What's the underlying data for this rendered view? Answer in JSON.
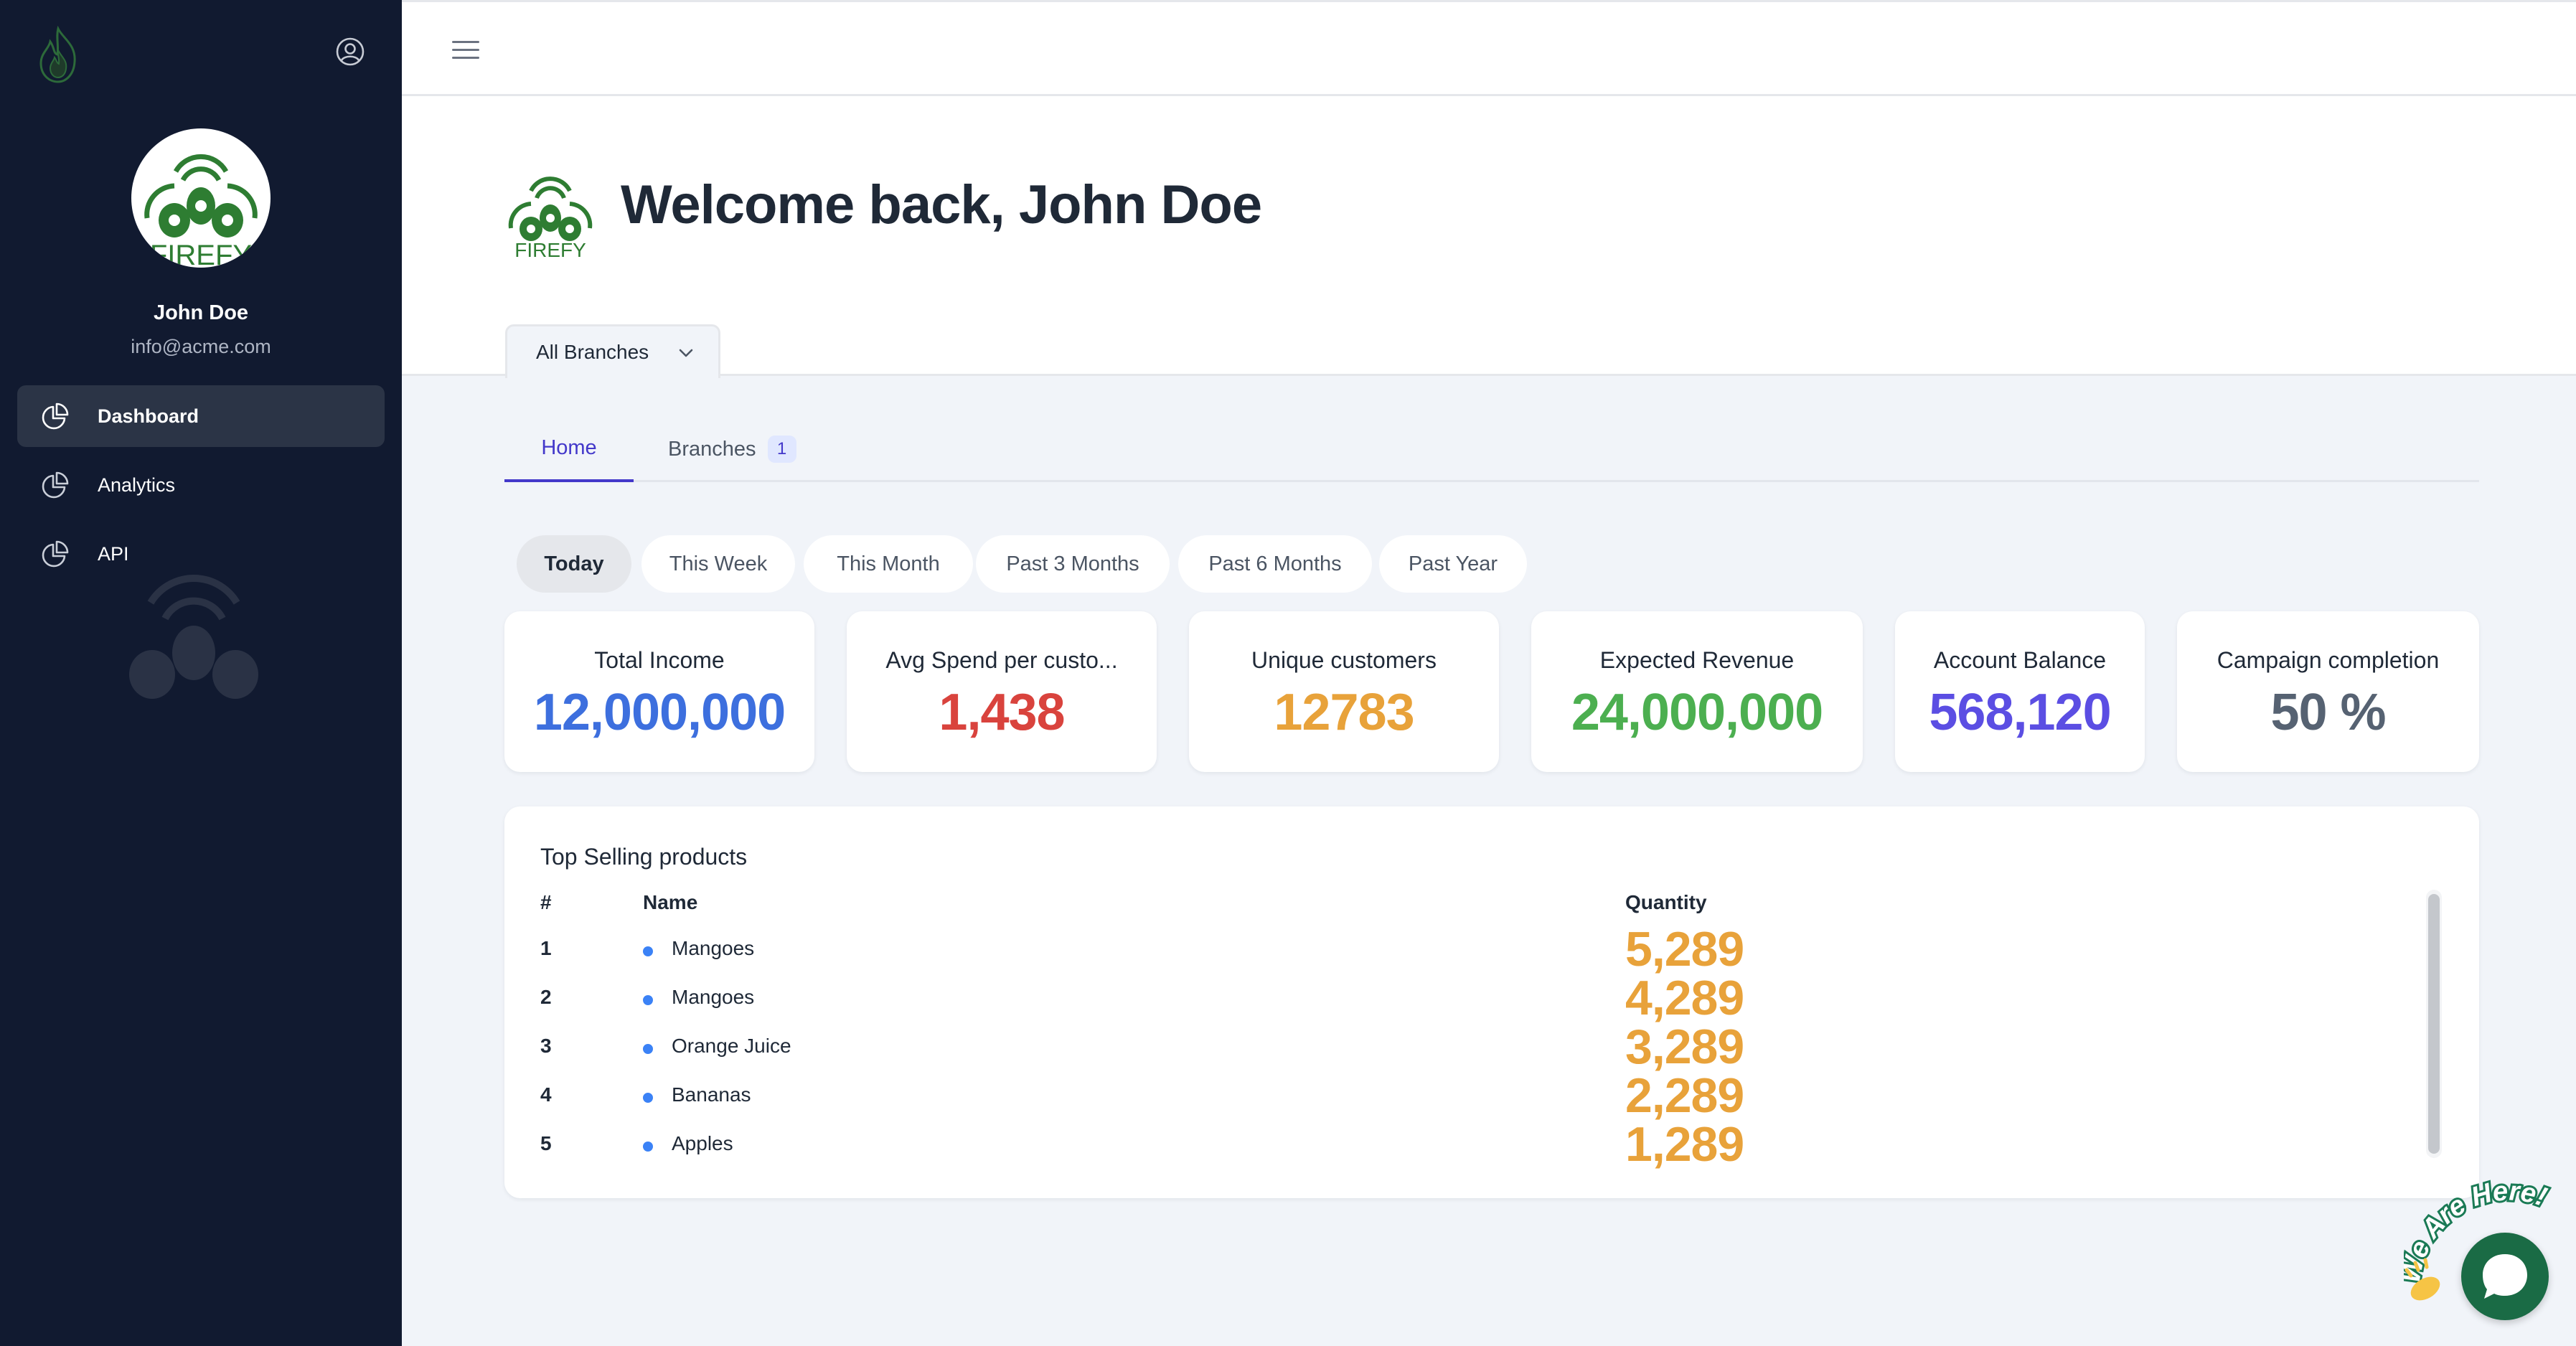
{
  "sidebar": {
    "user_name": "John Doe",
    "user_email": "info@acme.com",
    "avatar_text": "FIREFY",
    "nav": [
      {
        "label": "Dashboard",
        "active": true
      },
      {
        "label": "Analytics",
        "active": false
      },
      {
        "label": "API",
        "active": false
      }
    ]
  },
  "header": {
    "welcome": "Welcome back, John Doe",
    "logo_text": "FIREFY",
    "branch_select": "All Branches"
  },
  "tabs": [
    {
      "label": "Home",
      "active": true
    },
    {
      "label": "Branches",
      "badge": "1",
      "active": false
    }
  ],
  "periods": [
    "Today",
    "This Week",
    "This Month",
    "Past 3 Months",
    "Past 6 Months",
    "Past Year"
  ],
  "active_period": "Today",
  "stats": [
    {
      "title": "Total Income",
      "value": "12,000,000",
      "color": "#3d6fde"
    },
    {
      "title": "Avg Spend per custo...",
      "value": "1,438",
      "color": "#d9433d"
    },
    {
      "title": "Unique customers",
      "value": "12783",
      "color": "#e8a23a"
    },
    {
      "title": "Expected Revenue",
      "value": "24,000,000",
      "color": "#4caf50"
    },
    {
      "title": "Account Balance",
      "value": "568,120",
      "color": "#5b4ee3"
    },
    {
      "title": "Campaign completion",
      "value": "50 %",
      "color": "#566272"
    }
  ],
  "top_products": {
    "title": "Top Selling products",
    "headers": {
      "num": "#",
      "name": "Name",
      "qty": "Quantity"
    },
    "rows": [
      {
        "num": "1",
        "name": "Mangoes",
        "qty": "5,289"
      },
      {
        "num": "2",
        "name": "Mangoes",
        "qty": "4,289"
      },
      {
        "num": "3",
        "name": "Orange Juice",
        "qty": "3,289"
      },
      {
        "num": "4",
        "name": "Bananas",
        "qty": "2,289"
      },
      {
        "num": "5",
        "name": "Apples",
        "qty": "1,289"
      }
    ]
  },
  "chat": {
    "tag": "We Are Here!"
  },
  "colors": {
    "sidebar_bg": "#111a30",
    "accent": "#4338ca",
    "brand_green": "#2e7d32",
    "qty": "#e8a23a",
    "chat": "#1a6b45"
  }
}
